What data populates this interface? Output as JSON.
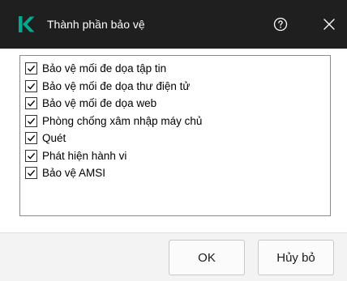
{
  "window": {
    "title": "Thành phần bảo vệ",
    "logo_icon": "kaspersky-k-logo",
    "brand_color": "#00a88e",
    "help_icon": "help-circle-icon",
    "close_icon": "close-icon"
  },
  "components": [
    {
      "label": "Bảo vệ mối đe dọa tập tin",
      "checked": true
    },
    {
      "label": "Bảo vệ mối đe dọa thư điện tử",
      "checked": true
    },
    {
      "label": "Bảo vệ mối đe dọa web",
      "checked": true
    },
    {
      "label": "Phòng chống xâm nhập máy chủ",
      "checked": true
    },
    {
      "label": "Quét",
      "checked": true
    },
    {
      "label": "Phát hiện hành vi",
      "checked": true
    },
    {
      "label": "Bảo vệ AMSI",
      "checked": true
    }
  ],
  "buttons": {
    "ok": "OK",
    "cancel": "Hủy bỏ"
  }
}
